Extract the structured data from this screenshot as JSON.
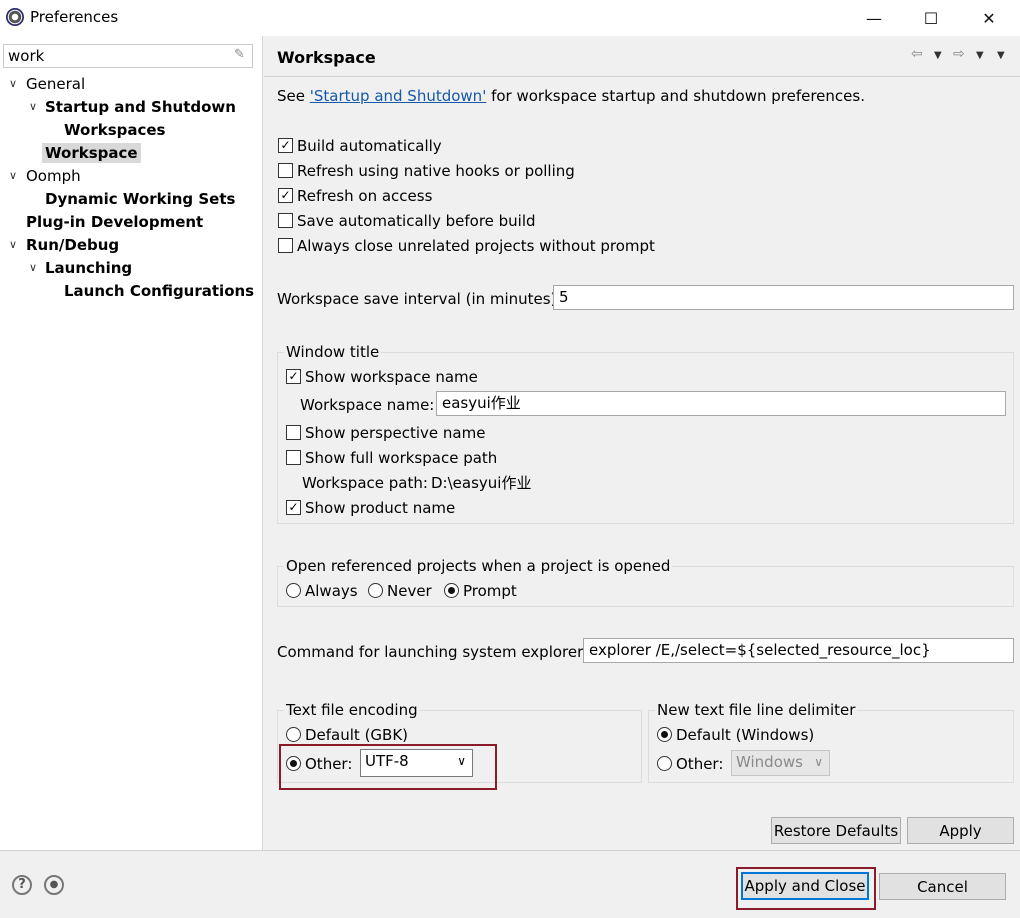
{
  "window": {
    "title": "Preferences"
  },
  "filter": {
    "value": "work"
  },
  "tree": [
    {
      "label": "General",
      "bold": false
    },
    {
      "label": "Startup and Shutdown",
      "bold": true
    },
    {
      "label": "Workspaces",
      "bold": true
    },
    {
      "label": "Workspace",
      "bold": true,
      "selected": true
    },
    {
      "label": "Oomph",
      "bold": false
    },
    {
      "label": "Dynamic Working Sets",
      "bold": true
    },
    {
      "label": "Plug-in Development",
      "bold": true
    },
    {
      "label": "Run/Debug",
      "bold": true
    },
    {
      "label": "Launching",
      "bold": true
    },
    {
      "label": "Launch Configurations",
      "bold": true
    }
  ],
  "page": {
    "title": "Workspace",
    "intro_prefix": "See ",
    "intro_link": "'Startup and Shutdown'",
    "intro_suffix": " for workspace startup and shutdown preferences.",
    "checkboxes": [
      {
        "label": "Build automatically",
        "checked": true
      },
      {
        "label": "Refresh using native hooks or polling",
        "checked": false
      },
      {
        "label": "Refresh on access",
        "checked": true
      },
      {
        "label": "Save automatically before build",
        "checked": false
      },
      {
        "label": "Always close unrelated projects without prompt",
        "checked": false
      }
    ],
    "save_interval_label": "Workspace save interval (in minutes):",
    "save_interval_value": "5",
    "window_title": {
      "group_label": "Window title",
      "show_workspace_name": "Show workspace name",
      "workspace_name_label": "Workspace name:",
      "workspace_name_value": "easyui作业",
      "show_perspective_name": "Show perspective name",
      "show_full_path": "Show full workspace path",
      "workspace_path_label": "Workspace path:",
      "workspace_path_value": "D:\\easyui作业",
      "show_product_name": "Show product name"
    },
    "open_referenced": {
      "group_label": "Open referenced projects when a project is opened",
      "options": [
        "Always",
        "Never",
        "Prompt"
      ],
      "selected": "Prompt"
    },
    "explorer_label": "Command for launching system explorer:",
    "explorer_value": "explorer /E,/select=${selected_resource_loc}",
    "encoding": {
      "group_label": "Text file encoding",
      "default_label": "Default (GBK)",
      "other_label": "Other:",
      "other_value": "UTF-8",
      "selected": "Other"
    },
    "line_delimiter": {
      "group_label": "New text file line delimiter",
      "default_label": "Default (Windows)",
      "other_label": "Other:",
      "other_value": "Windows",
      "selected": "Default"
    },
    "restore_defaults": "Restore Defaults",
    "apply": "Apply"
  },
  "footer": {
    "apply_and_close": "Apply and Close",
    "cancel": "Cancel"
  },
  "colors": {
    "highlight_box": "#8b1a2a",
    "link": "#1558a8",
    "focus_border": "#0078d7"
  }
}
